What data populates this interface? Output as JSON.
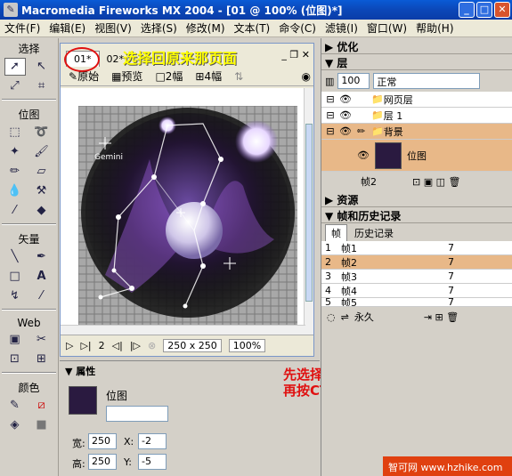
{
  "window": {
    "title": "Macromedia Fireworks MX 2004 - [01 @ 100% (位图)*]"
  },
  "menu": [
    "文件(F)",
    "编辑(E)",
    "视图(V)",
    "选择(S)",
    "修改(M)",
    "文本(T)",
    "命令(C)",
    "滤镜(I)",
    "窗口(W)",
    "帮助(H)"
  ],
  "tools": {
    "select_label": "选择",
    "bitmap_label": "位图",
    "vector_label": "矢量",
    "web_label": "Web",
    "color_label": "颜色"
  },
  "document": {
    "tabs": [
      "01*",
      "02*"
    ],
    "annotation": "选择回原来那页面",
    "views": [
      "原始",
      "预览",
      "2幅",
      "4幅"
    ],
    "star_label": "Gemini",
    "frame_num": "2",
    "size": "250 x 250",
    "zoom": "100%"
  },
  "properties": {
    "title": "属性",
    "type": "位图",
    "width_label": "宽:",
    "width": "250",
    "height_label": "高:",
    "height": "250",
    "x_label": "X:",
    "x": "-2",
    "y_label": "Y:",
    "y": "-5"
  },
  "annotation2": [
    "先选择第面帧，",
    "再按CTRL+V复制图片。"
  ],
  "panels": {
    "optimize": "优化",
    "layers": "层",
    "opacity": "100",
    "blend": "正常",
    "layer_items": [
      {
        "name": "网页层"
      },
      {
        "name": "层 1"
      },
      {
        "name": "背景"
      }
    ],
    "sublayer": "位图",
    "frame_label": "帧2",
    "assets": "资源",
    "frames_history": "帧和历史记录",
    "frames_tab": "帧",
    "history_tab": "历史记录",
    "frames": [
      {
        "num": "1",
        "name": "帧1",
        "delay": "7"
      },
      {
        "num": "2",
        "name": "帧2",
        "delay": "7"
      },
      {
        "num": "3",
        "name": "帧3",
        "delay": "7"
      },
      {
        "num": "4",
        "name": "帧4",
        "delay": "7"
      },
      {
        "num": "5",
        "name": "帧5",
        "delay": "7"
      }
    ],
    "loop": "永久"
  },
  "watermark": "智可网 www.hzhike.com"
}
